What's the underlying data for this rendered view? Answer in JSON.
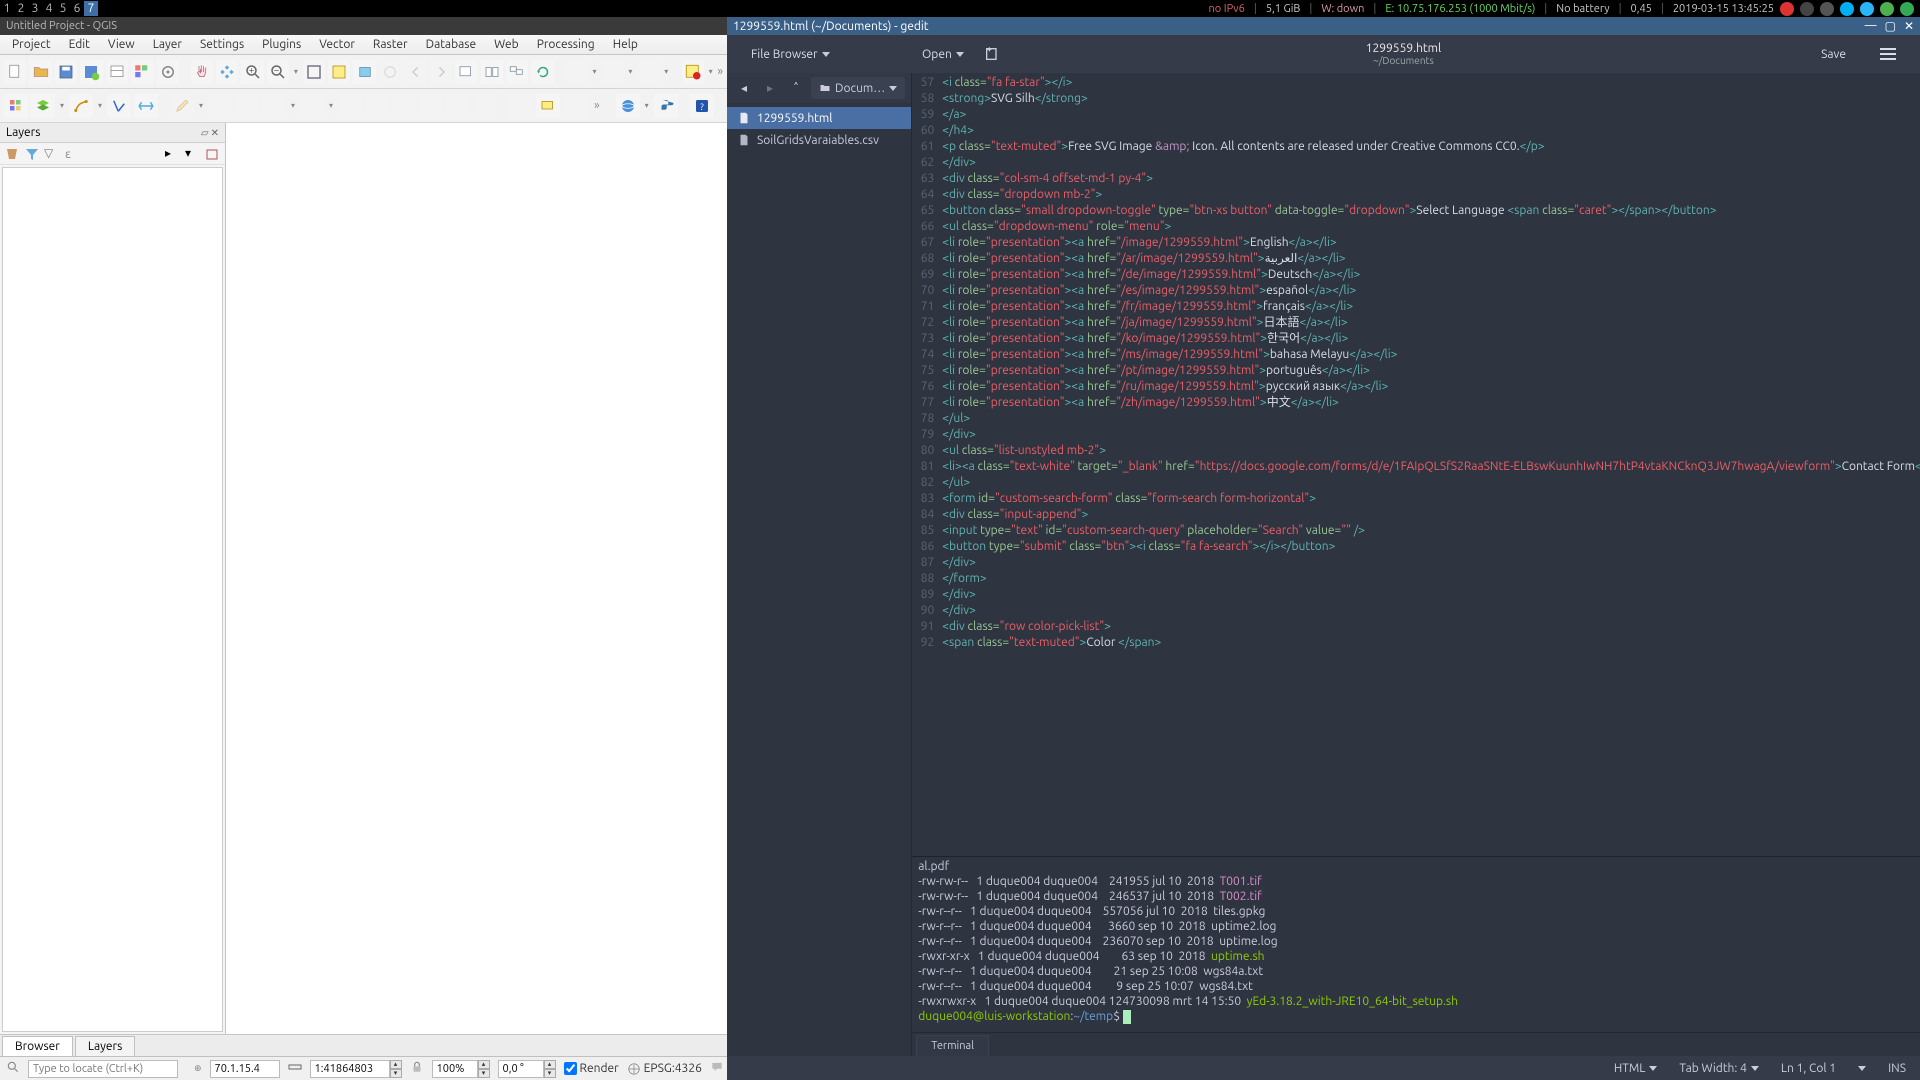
{
  "panel": {
    "workspaces": [
      "1",
      "2",
      "3",
      "4",
      "5",
      "6",
      "7"
    ],
    "active_ws": 6,
    "ipv6": "no IPv6",
    "mem": "5,1 GiB",
    "wifi": "W: down",
    "eth": "E: 10.75.176.253 (1000 Mbit/s)",
    "bat": "No battery",
    "load": "0,45",
    "clock": "2019-03-15 13:45:25"
  },
  "qgis": {
    "title": "Untitled Project - QGIS",
    "menu": [
      "Project",
      "Edit",
      "View",
      "Layer",
      "Settings",
      "Plugins",
      "Vector",
      "Raster",
      "Database",
      "Web",
      "Processing",
      "Help"
    ],
    "layers_title": "Layers",
    "bottom_tabs": [
      "Browser",
      "Layers"
    ],
    "active_bottom_tab": 0,
    "status": {
      "locator_ph": "Type to locate (Ctrl+K)",
      "coord": "70.1.15.4",
      "scale": "1:41864803",
      "mag": "100%",
      "rot": "0,0 °",
      "render": "Render",
      "crs": "EPSG:4326",
      "scale_lbl": "",
      "mag_lbl": ""
    }
  },
  "gedit": {
    "title": "1299559.html (~/Documents) - gedit",
    "file_browser_lbl": "File Browser",
    "open_lbl": "Open",
    "save_lbl": "Save",
    "tab_name": "1299559.html",
    "tab_path": "~/Documents",
    "crumb_icon": "folder",
    "crumb": "Docum…",
    "files": [
      {
        "name": "1299559.html",
        "sel": true,
        "icon": "html"
      },
      {
        "name": "SoilGridsVaraiables.csv",
        "sel": false,
        "icon": "csv"
      }
    ],
    "term_tab": "Terminal",
    "status": {
      "lang": "HTML",
      "tabwidth": "Tab Width: 4",
      "pos": "Ln 1, Col 1",
      "ins": "INS"
    },
    "code_lines": [
      {
        "n": 57,
        "h": "<span class='c-tag'>&lt;i</span> <span class='c-attr'>class=</span><span class='c-str'>\"fa fa-star\"</span><span class='c-tag'>&gt;&lt;/i&gt;</span>"
      },
      {
        "n": 58,
        "h": "<span class='c-tag'>&lt;strong&gt;</span>SVG Silh<span class='c-tag'>&lt;/strong&gt;</span>"
      },
      {
        "n": 59,
        "h": "<span class='c-tag'>&lt;/a&gt;</span>"
      },
      {
        "n": 60,
        "h": "<span class='c-tag'>&lt;/h4&gt;</span>"
      },
      {
        "n": 61,
        "h": "<span class='c-tag'>&lt;p</span> <span class='c-attr'>class=</span><span class='c-str'>\"text-muted\"</span><span class='c-tag'>&gt;</span>Free SVG Image <span class='c-ent'>&amp;amp;</span> Icon. All contents are released under Creative Commons CC0.<span class='c-tag'>&lt;/p&gt;</span>"
      },
      {
        "n": 62,
        "h": "<span class='c-tag'>&lt;/div&gt;</span>"
      },
      {
        "n": 63,
        "h": "<span class='c-tag'>&lt;div</span> <span class='c-attr'>class=</span><span class='c-str'>\"col-sm-4 offset-md-1 py-4\"</span><span class='c-tag'>&gt;</span>"
      },
      {
        "n": 64,
        "h": "<span class='c-tag'>&lt;div</span> <span class='c-attr'>class=</span><span class='c-str'>\"dropdown mb-2\"</span><span class='c-tag'>&gt;</span>"
      },
      {
        "n": 65,
        "h": "<span class='c-tag'>&lt;button</span> <span class='c-attr'>class=</span><span class='c-str'>\"small dropdown-toggle\"</span> <span class='c-attr'>type=</span><span class='c-str'>\"btn-xs button\"</span> <span class='c-attr'>data-toggle=</span><span class='c-str'>\"dropdown\"</span><span class='c-tag'>&gt;</span>Select Language <span class='c-tag'>&lt;span</span> <span class='c-attr'>class=</span><span class='c-str'>\"caret\"</span><span class='c-tag'>&gt;&lt;/span&gt;&lt;/button&gt;</span>"
      },
      {
        "n": 66,
        "h": "<span class='c-tag'>&lt;ul</span> <span class='c-attr'>class=</span><span class='c-str'>\"dropdown-menu\"</span> <span class='c-attr'>role=</span><span class='c-str'>\"menu\"</span><span class='c-tag'>&gt;</span>"
      },
      {
        "n": 67,
        "h": "<span class='c-tag'>&lt;li</span> <span class='c-attr'>role=</span><span class='c-str'>\"presentation\"</span><span class='c-tag'>&gt;&lt;a</span> <span class='c-attr'>href=</span><span class='c-str'>\"/image/1299559.html\"</span><span class='c-tag'>&gt;</span>English<span class='c-tag'>&lt;/a&gt;&lt;/li&gt;</span>"
      },
      {
        "n": 68,
        "h": "<span class='c-tag'>&lt;li</span> <span class='c-attr'>role=</span><span class='c-str'>\"presentation\"</span><span class='c-tag'>&gt;&lt;a</span> <span class='c-attr'>href=</span><span class='c-str'>\"/ar/image/1299559.html\"</span><span class='c-tag'>&gt;</span>العربية<span class='c-tag'>&lt;/a&gt;&lt;/li&gt;</span>"
      },
      {
        "n": 69,
        "h": "<span class='c-tag'>&lt;li</span> <span class='c-attr'>role=</span><span class='c-str'>\"presentation\"</span><span class='c-tag'>&gt;&lt;a</span> <span class='c-attr'>href=</span><span class='c-str'>\"/de/image/1299559.html\"</span><span class='c-tag'>&gt;</span>Deutsch<span class='c-tag'>&lt;/a&gt;&lt;/li&gt;</span>"
      },
      {
        "n": 70,
        "h": "<span class='c-tag'>&lt;li</span> <span class='c-attr'>role=</span><span class='c-str'>\"presentation\"</span><span class='c-tag'>&gt;&lt;a</span> <span class='c-attr'>href=</span><span class='c-str'>\"/es/image/1299559.html\"</span><span class='c-tag'>&gt;</span>español<span class='c-tag'>&lt;/a&gt;&lt;/li&gt;</span>"
      },
      {
        "n": 71,
        "h": "<span class='c-tag'>&lt;li</span> <span class='c-attr'>role=</span><span class='c-str'>\"presentation\"</span><span class='c-tag'>&gt;&lt;a</span> <span class='c-attr'>href=</span><span class='c-str'>\"/fr/image/1299559.html\"</span><span class='c-tag'>&gt;</span>français<span class='c-tag'>&lt;/a&gt;&lt;/li&gt;</span>"
      },
      {
        "n": 72,
        "h": "<span class='c-tag'>&lt;li</span> <span class='c-attr'>role=</span><span class='c-str'>\"presentation\"</span><span class='c-tag'>&gt;&lt;a</span> <span class='c-attr'>href=</span><span class='c-str'>\"/ja/image/1299559.html\"</span><span class='c-tag'>&gt;</span>日本語<span class='c-tag'>&lt;/a&gt;&lt;/li&gt;</span>"
      },
      {
        "n": 73,
        "h": "<span class='c-tag'>&lt;li</span> <span class='c-attr'>role=</span><span class='c-str'>\"presentation\"</span><span class='c-tag'>&gt;&lt;a</span> <span class='c-attr'>href=</span><span class='c-str'>\"/ko/image/1299559.html\"</span><span class='c-tag'>&gt;</span>한국어<span class='c-tag'>&lt;/a&gt;&lt;/li&gt;</span>"
      },
      {
        "n": 74,
        "h": "<span class='c-tag'>&lt;li</span> <span class='c-attr'>role=</span><span class='c-str'>\"presentation\"</span><span class='c-tag'>&gt;&lt;a</span> <span class='c-attr'>href=</span><span class='c-str'>\"/ms/image/1299559.html\"</span><span class='c-tag'>&gt;</span>bahasa Melayu<span class='c-tag'>&lt;/a&gt;&lt;/li&gt;</span>"
      },
      {
        "n": 75,
        "h": "<span class='c-tag'>&lt;li</span> <span class='c-attr'>role=</span><span class='c-str'>\"presentation\"</span><span class='c-tag'>&gt;&lt;a</span> <span class='c-attr'>href=</span><span class='c-str'>\"/pt/image/1299559.html\"</span><span class='c-tag'>&gt;</span>português<span class='c-tag'>&lt;/a&gt;&lt;/li&gt;</span>"
      },
      {
        "n": 76,
        "h": "<span class='c-tag'>&lt;li</span> <span class='c-attr'>role=</span><span class='c-str'>\"presentation\"</span><span class='c-tag'>&gt;&lt;a</span> <span class='c-attr'>href=</span><span class='c-str'>\"/ru/image/1299559.html\"</span><span class='c-tag'>&gt;</span>русский язык<span class='c-tag'>&lt;/a&gt;&lt;/li&gt;</span>"
      },
      {
        "n": 77,
        "h": "<span class='c-tag'>&lt;li</span> <span class='c-attr'>role=</span><span class='c-str'>\"presentation\"</span><span class='c-tag'>&gt;&lt;a</span> <span class='c-attr'>href=</span><span class='c-str'>\"/zh/image/1299559.html\"</span><span class='c-tag'>&gt;</span>中文<span class='c-tag'>&lt;/a&gt;&lt;/li&gt;</span>"
      },
      {
        "n": 78,
        "h": "<span class='c-tag'>&lt;/ul&gt;</span>"
      },
      {
        "n": 79,
        "h": "<span class='c-tag'>&lt;/div&gt;</span>"
      },
      {
        "n": 80,
        "h": "<span class='c-tag'>&lt;ul</span> <span class='c-attr'>class=</span><span class='c-str'>\"list-unstyled mb-2\"</span><span class='c-tag'>&gt;</span>"
      },
      {
        "n": 81,
        "h": "<span class='c-tag'>&lt;li&gt;&lt;a</span> <span class='c-attr'>class=</span><span class='c-str'>\"text-white\"</span> <span class='c-attr'>target=</span><span class='c-str'>\"_blank\"</span> <span class='c-attr'>href=</span><span class='c-str'>\"https://docs.google.com/forms/d/e/1FAIpQLSfS2RaaSNtE-ELBswKuunhIwNH7htP4vtaKNCknQ3JW7hwagA/viewform\"</span><span class='c-tag'>&gt;</span>Contact Form<span class='c-tag'>&lt;/a&gt;&lt;/li&gt;</span>"
      },
      {
        "n": 82,
        "h": "<span class='c-tag'>&lt;/ul&gt;</span>"
      },
      {
        "n": 83,
        "h": "<span class='c-tag'>&lt;form</span> <span class='c-attr'>id=</span><span class='c-str'>\"custom-search-form\"</span> <span class='c-attr'>class=</span><span class='c-str'>\"form-search form-horizontal\"</span><span class='c-tag'>&gt;</span>"
      },
      {
        "n": 84,
        "h": "<span class='c-tag'>&lt;div</span> <span class='c-attr'>class=</span><span class='c-str'>\"input-append\"</span><span class='c-tag'>&gt;</span>"
      },
      {
        "n": 85,
        "h": "<span class='c-tag'>&lt;input</span> <span class='c-attr'>type=</span><span class='c-str'>\"text\"</span> <span class='c-attr'>id=</span><span class='c-str'>\"custom-search-query\"</span> <span class='c-attr'>placeholder=</span><span class='c-str'>\"Search\"</span> <span class='c-attr'>value=</span><span class='c-str'>\"\"</span> <span class='c-tag'>/&gt;</span>"
      },
      {
        "n": 86,
        "h": "<span class='c-tag'>&lt;button</span> <span class='c-attr'>type=</span><span class='c-str'>\"submit\"</span> <span class='c-attr'>class=</span><span class='c-str'>\"btn\"</span><span class='c-tag'>&gt;&lt;i</span> <span class='c-attr'>class=</span><span class='c-str'>\"fa fa-search\"</span><span class='c-tag'>&gt;&lt;/i&gt;&lt;/button&gt;</span>"
      },
      {
        "n": 87,
        "h": "<span class='c-tag'>&lt;/div&gt;</span>"
      },
      {
        "n": 88,
        "h": "<span class='c-tag'>&lt;/form&gt;</span>"
      },
      {
        "n": 89,
        "h": "<span class='c-tag'>&lt;/div&gt;</span>"
      },
      {
        "n": 90,
        "h": "<span class='c-tag'>&lt;/div&gt;</span>"
      },
      {
        "n": 91,
        "h": "<span class='c-tag'>&lt;div</span> <span class='c-attr'>class=</span><span class='c-str'>\"row color-pick-list\"</span><span class='c-tag'>&gt;</span>"
      },
      {
        "n": 92,
        "h": "<span class='c-tag'>&lt;span</span> <span class='c-attr'>class=</span><span class='c-str'>\"text-muted\"</span><span class='c-tag'>&gt;</span>Color <span class='c-tag'>&lt;/span&gt;</span>"
      }
    ],
    "term_lines": [
      {
        "t": "al.pdf",
        "cls": ""
      },
      {
        "t": "-rw-rw-r--   1 duque004 duque004    241955 jul 10  2018  ",
        "tail": "T001.tif",
        "tc": "t-pink"
      },
      {
        "t": "-rw-rw-r--   1 duque004 duque004    246537 jul 10  2018  ",
        "tail": "T002.tif",
        "tc": "t-pink"
      },
      {
        "t": "-rw-r--r--   1 duque004 duque004    557056 jul 10  2018  tiles.gpkg"
      },
      {
        "t": "-rw-r--r--   1 duque004 duque004      3660 sep 10  2018  uptime2.log"
      },
      {
        "t": "-rw-r--r--   1 duque004 duque004    236070 sep 10  2018  uptime.log"
      },
      {
        "t": "-rwxr-xr-x   1 duque004 duque004        63 sep 10  2018  ",
        "tail": "uptime.sh",
        "tc": "t-grn"
      },
      {
        "t": "-rw-r--r--   1 duque004 duque004        21 sep 25 10:08  wgs84a.txt"
      },
      {
        "t": "-rw-r--r--   1 duque004 duque004         9 sep 25 10:07  wgs84.txt"
      },
      {
        "t": "-rwxrwxr-x   1 duque004 duque004 124730098 mrt 14 15:50  ",
        "tail": "yEd-3.18.2_with-JRE10_64-bit_setup.sh",
        "tc": "t-grn"
      }
    ],
    "prompt_user": "duque004@luis-workstation",
    "prompt_path": "~/temp"
  }
}
